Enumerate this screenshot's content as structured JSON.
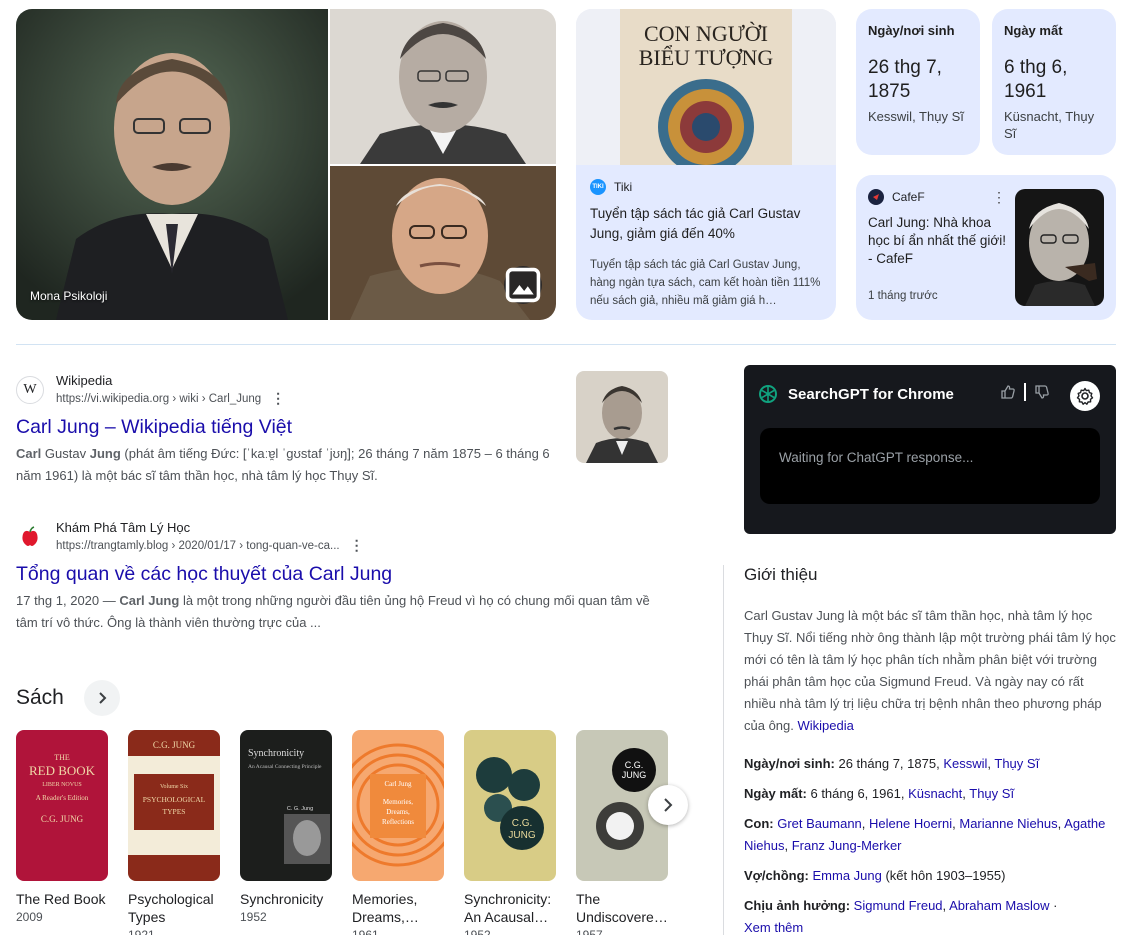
{
  "images": {
    "main_caption": "Mona Psikoloji"
  },
  "tiki": {
    "source": "Tiki",
    "logo": "TIKI",
    "cover_title_1": "CON NGƯỜI",
    "cover_title_2": "BIỂU TƯỢNG",
    "title": "Tuyển tập sách tác giả Carl Gustav Jung, giảm giá đến 40%",
    "desc": "Tuyển tập sách tác giả Carl Gustav Jung, hàng ngàn tựa sách, cam kết hoàn tiền 111% nếu sách giả, nhiều mã giảm giá h…"
  },
  "birth": {
    "label": "Ngày/nơi sinh",
    "value": "26 thg 7, 1875",
    "place": "Kesswil, Thụy Sĩ"
  },
  "death": {
    "label": "Ngày mất",
    "value": "6 thg 6, 1961",
    "place": "Küsnacht, Thụy Sĩ"
  },
  "cafef": {
    "source": "CafeF",
    "title": "Carl Jung: Nhà khoa học bí ẩn nhất thế giới! - CafeF",
    "time": "1 tháng trước"
  },
  "results": [
    {
      "site": "Wikipedia",
      "favicon": "W",
      "url": "https://vi.wikipedia.org › wiki › Carl_Jung",
      "title": "Carl Jung – Wikipedia tiếng Việt",
      "snippet_b1": "Carl",
      "snippet_t1": " Gustav ",
      "snippet_b2": "Jung",
      "snippet_t2": " (phát âm tiếng Đức: [ˈkaːɐ̯l ˈɡʊstaf ˈjʊŋ]; 26 tháng 7 năm 1875 – 6 tháng 6 năm 1961) là một bác sĩ tâm thần học, nhà tâm lý học Thụy Sĩ."
    },
    {
      "site": "Khám Phá Tâm Lý Học",
      "url": "https://trangtamly.blog › 2020/01/17 › tong-quan-ve-ca...",
      "title": "Tổng quan về các học thuyết của Carl Jung",
      "snippet_date": "17 thg 1, 2020 — ",
      "snippet_b1": "Carl Jung",
      "snippet_t1": " là một trong những người đầu tiên ủng hộ Freud vì họ có chung mối quan tâm về tâm trí vô thức. Ông là thành viên thường trực của ..."
    }
  ],
  "books": {
    "heading": "Sách",
    "items": [
      {
        "title": "The Red Book",
        "year": "2009",
        "cover_t1": "THE",
        "cover_t2": "RED BOOK",
        "cover_t3": "LIBER NOVUS",
        "cover_t4": "A Reader's Edition",
        "cover_author": "C.G. JUNG",
        "bg": "#b0143a"
      },
      {
        "title": "Psychological Types",
        "year": "1921",
        "cover_author": "C.G. JUNG",
        "cover_t1": "Volume Six",
        "cover_t2": "PSYCHOLOGICAL",
        "cover_t3": "TYPES",
        "bg": "#8a2a1a"
      },
      {
        "title": "Synchronicity",
        "year": "1952",
        "cover_t1": "Synchronicity",
        "cover_t2": "An Acausal Connecting Principle",
        "cover_author": "C. G. Jung",
        "bg": "#1c1e1c"
      },
      {
        "title": "Memories, Dreams, Reflections",
        "year": "1961",
        "cover_author": "Carl Jung",
        "cover_t1": "Memories,",
        "cover_t2": "Dreams,",
        "cover_t3": "Reflections",
        "bg": "#f08a3c"
      },
      {
        "title": "Synchronicity: An Acausal Connecting Principle",
        "year": "1952",
        "cover_t1": "C.G.",
        "cover_t2": "JUNG",
        "bg": "#d8cc86"
      },
      {
        "title": "The Undiscovered Self",
        "year": "1957",
        "cover_t1": "C.G.",
        "cover_t2": "JUNG",
        "bg": "#c7c8b7"
      }
    ]
  },
  "gpt": {
    "title": "SearchGPT for Chrome",
    "waiting": "Waiting for ChatGPT response..."
  },
  "kp": {
    "title": "Giới thiệu",
    "desc": "Carl Gustav Jung là một bác sĩ tâm thần học, nhà tâm lý học Thụy Sĩ. Nổi tiếng nhờ ông thành lập một trường phái tâm lý học mới có tên là tâm lý học phân tích nhằm phân biệt với trường phái phân tâm học của Sigmund Freud. Và ngày nay có rất nhiều nhà tâm lý trị liệu chữa trị bệnh nhân theo phương pháp của ông.",
    "desc_link": "Wikipedia",
    "birth_label": "Ngày/nơi sinh:",
    "birth_text": " 26 tháng 7, 1875, ",
    "birth_link1": "Kesswil",
    "birth_link2": "Thụy Sĩ",
    "death_label": "Ngày mất:",
    "death_text": " 6 tháng 6, 1961, ",
    "death_link1": "Küsnacht",
    "death_link2": "Thụy Sĩ",
    "children_label": "Con:",
    "children": [
      "Gret Baumann",
      "Helene Hoerni",
      "Marianne Niehus",
      "Agathe Niehus",
      "Franz Jung-Merker"
    ],
    "spouse_label": "Vợ/chồng:",
    "spouse_link": "Emma Jung",
    "spouse_text": " (kết hôn 1903–1955)",
    "influence_label": "Chịu ảnh hưởng:",
    "influence_link1": "Sigmund Freud",
    "influence_link2": "Abraham Maslow",
    "more": "Xem thêm"
  }
}
